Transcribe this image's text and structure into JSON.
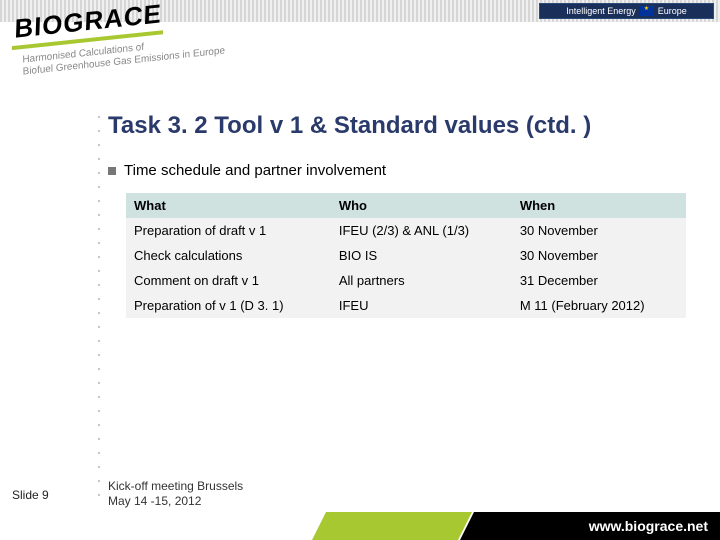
{
  "logo": {
    "main": "BIOGRACE",
    "tagline1": "Harmonised Calculations of",
    "tagline2": "Biofuel Greenhouse Gas Emissions in Europe"
  },
  "badge": {
    "text": "Intelligent Energy",
    "europe": "Europe"
  },
  "title": "Task 3. 2 Tool v 1 & Standard values (ctd. )",
  "bullet": "Time schedule and partner involvement",
  "table": {
    "headers": {
      "what": "What",
      "who": "Who",
      "when": "When"
    },
    "rows": [
      {
        "what": "Preparation of draft v 1",
        "who": "IFEU (2/3) & ANL (1/3)",
        "when": "30 November"
      },
      {
        "what": "Check calculations",
        "who": "BIO IS",
        "when": "30 November"
      },
      {
        "what": "Comment on draft v 1",
        "who": "All partners",
        "when": "31 December"
      },
      {
        "what": "Preparation of v 1 (D 3. 1)",
        "who": "IFEU",
        "when": "M 11 (February 2012)"
      }
    ]
  },
  "slide": "Slide 9",
  "kickoff": {
    "l1": "Kick-off meeting Brussels",
    "l2": "May 14 -15, 2012"
  },
  "url": "www.biograce.net"
}
